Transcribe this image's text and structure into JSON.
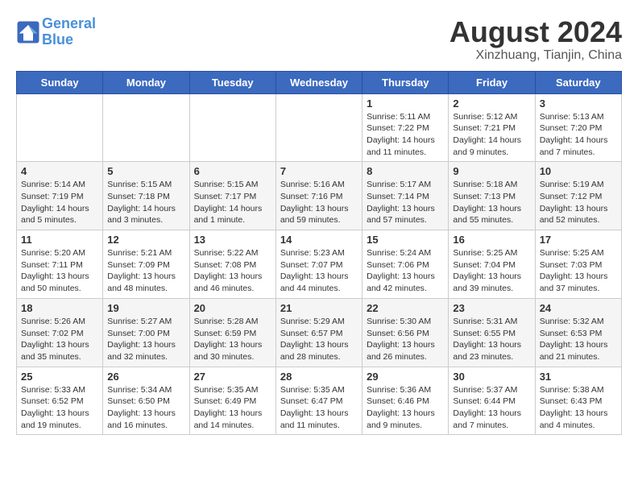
{
  "header": {
    "logo_line1": "General",
    "logo_line2": "Blue",
    "month_year": "August 2024",
    "location": "Xinzhuang, Tianjin, China"
  },
  "days_of_week": [
    "Sunday",
    "Monday",
    "Tuesday",
    "Wednesday",
    "Thursday",
    "Friday",
    "Saturday"
  ],
  "weeks": [
    [
      {
        "day": "",
        "info": ""
      },
      {
        "day": "",
        "info": ""
      },
      {
        "day": "",
        "info": ""
      },
      {
        "day": "",
        "info": ""
      },
      {
        "day": "1",
        "info": "Sunrise: 5:11 AM\nSunset: 7:22 PM\nDaylight: 14 hours\nand 11 minutes."
      },
      {
        "day": "2",
        "info": "Sunrise: 5:12 AM\nSunset: 7:21 PM\nDaylight: 14 hours\nand 9 minutes."
      },
      {
        "day": "3",
        "info": "Sunrise: 5:13 AM\nSunset: 7:20 PM\nDaylight: 14 hours\nand 7 minutes."
      }
    ],
    [
      {
        "day": "4",
        "info": "Sunrise: 5:14 AM\nSunset: 7:19 PM\nDaylight: 14 hours\nand 5 minutes."
      },
      {
        "day": "5",
        "info": "Sunrise: 5:15 AM\nSunset: 7:18 PM\nDaylight: 14 hours\nand 3 minutes."
      },
      {
        "day": "6",
        "info": "Sunrise: 5:15 AM\nSunset: 7:17 PM\nDaylight: 14 hours\nand 1 minute."
      },
      {
        "day": "7",
        "info": "Sunrise: 5:16 AM\nSunset: 7:16 PM\nDaylight: 13 hours\nand 59 minutes."
      },
      {
        "day": "8",
        "info": "Sunrise: 5:17 AM\nSunset: 7:14 PM\nDaylight: 13 hours\nand 57 minutes."
      },
      {
        "day": "9",
        "info": "Sunrise: 5:18 AM\nSunset: 7:13 PM\nDaylight: 13 hours\nand 55 minutes."
      },
      {
        "day": "10",
        "info": "Sunrise: 5:19 AM\nSunset: 7:12 PM\nDaylight: 13 hours\nand 52 minutes."
      }
    ],
    [
      {
        "day": "11",
        "info": "Sunrise: 5:20 AM\nSunset: 7:11 PM\nDaylight: 13 hours\nand 50 minutes."
      },
      {
        "day": "12",
        "info": "Sunrise: 5:21 AM\nSunset: 7:09 PM\nDaylight: 13 hours\nand 48 minutes."
      },
      {
        "day": "13",
        "info": "Sunrise: 5:22 AM\nSunset: 7:08 PM\nDaylight: 13 hours\nand 46 minutes."
      },
      {
        "day": "14",
        "info": "Sunrise: 5:23 AM\nSunset: 7:07 PM\nDaylight: 13 hours\nand 44 minutes."
      },
      {
        "day": "15",
        "info": "Sunrise: 5:24 AM\nSunset: 7:06 PM\nDaylight: 13 hours\nand 42 minutes."
      },
      {
        "day": "16",
        "info": "Sunrise: 5:25 AM\nSunset: 7:04 PM\nDaylight: 13 hours\nand 39 minutes."
      },
      {
        "day": "17",
        "info": "Sunrise: 5:25 AM\nSunset: 7:03 PM\nDaylight: 13 hours\nand 37 minutes."
      }
    ],
    [
      {
        "day": "18",
        "info": "Sunrise: 5:26 AM\nSunset: 7:02 PM\nDaylight: 13 hours\nand 35 minutes."
      },
      {
        "day": "19",
        "info": "Sunrise: 5:27 AM\nSunset: 7:00 PM\nDaylight: 13 hours\nand 32 minutes."
      },
      {
        "day": "20",
        "info": "Sunrise: 5:28 AM\nSunset: 6:59 PM\nDaylight: 13 hours\nand 30 minutes."
      },
      {
        "day": "21",
        "info": "Sunrise: 5:29 AM\nSunset: 6:57 PM\nDaylight: 13 hours\nand 28 minutes."
      },
      {
        "day": "22",
        "info": "Sunrise: 5:30 AM\nSunset: 6:56 PM\nDaylight: 13 hours\nand 26 minutes."
      },
      {
        "day": "23",
        "info": "Sunrise: 5:31 AM\nSunset: 6:55 PM\nDaylight: 13 hours\nand 23 minutes."
      },
      {
        "day": "24",
        "info": "Sunrise: 5:32 AM\nSunset: 6:53 PM\nDaylight: 13 hours\nand 21 minutes."
      }
    ],
    [
      {
        "day": "25",
        "info": "Sunrise: 5:33 AM\nSunset: 6:52 PM\nDaylight: 13 hours\nand 19 minutes."
      },
      {
        "day": "26",
        "info": "Sunrise: 5:34 AM\nSunset: 6:50 PM\nDaylight: 13 hours\nand 16 minutes."
      },
      {
        "day": "27",
        "info": "Sunrise: 5:35 AM\nSunset: 6:49 PM\nDaylight: 13 hours\nand 14 minutes."
      },
      {
        "day": "28",
        "info": "Sunrise: 5:35 AM\nSunset: 6:47 PM\nDaylight: 13 hours\nand 11 minutes."
      },
      {
        "day": "29",
        "info": "Sunrise: 5:36 AM\nSunset: 6:46 PM\nDaylight: 13 hours\nand 9 minutes."
      },
      {
        "day": "30",
        "info": "Sunrise: 5:37 AM\nSunset: 6:44 PM\nDaylight: 13 hours\nand 7 minutes."
      },
      {
        "day": "31",
        "info": "Sunrise: 5:38 AM\nSunset: 6:43 PM\nDaylight: 13 hours\nand 4 minutes."
      }
    ]
  ]
}
